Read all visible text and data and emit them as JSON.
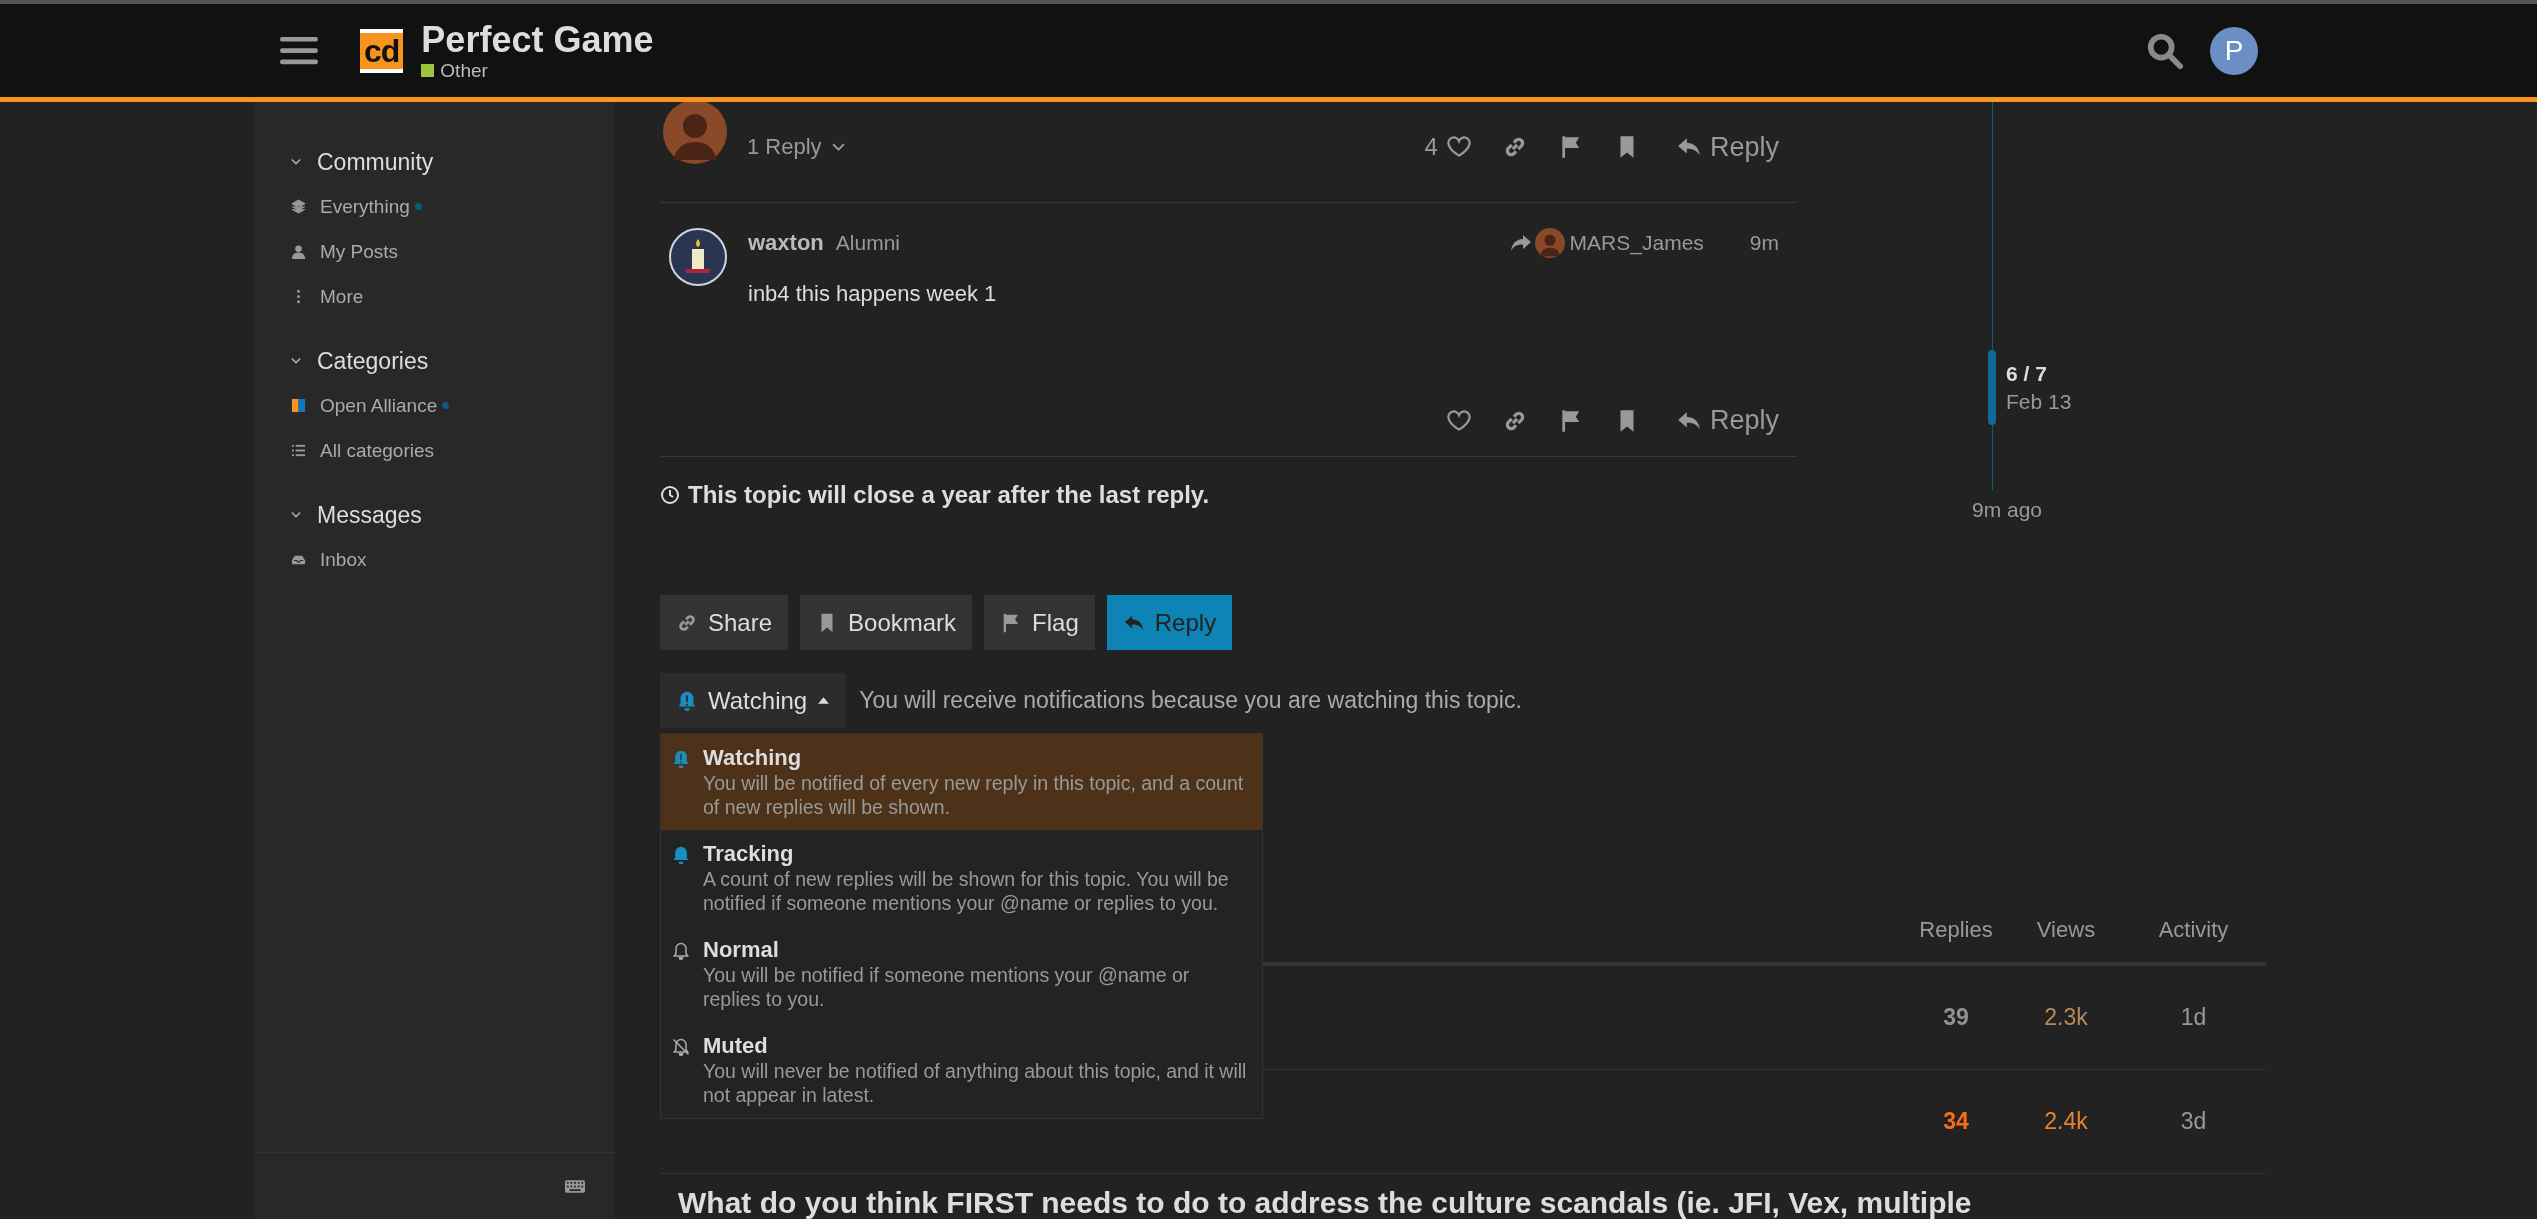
{
  "header": {
    "logo": "cd",
    "title": "Perfect Game",
    "category": {
      "name": "Other",
      "color": "#9bc53d"
    },
    "avatar_letter": "P"
  },
  "sidebar": {
    "sections": [
      {
        "title": "Community",
        "expanded": true,
        "items": [
          {
            "label": "Everything",
            "kind": "layers",
            "unread": true
          },
          {
            "label": "My Posts",
            "kind": "person",
            "unread": false
          },
          {
            "label": "More",
            "kind": "dots",
            "unread": false
          }
        ]
      },
      {
        "title": "Categories",
        "expanded": true,
        "items": [
          {
            "label": "Open Alliance",
            "kind": "category",
            "unread": true
          },
          {
            "label": "All categories",
            "kind": "list",
            "unread": false
          }
        ]
      },
      {
        "title": "Messages",
        "expanded": true,
        "items": [
          {
            "label": "Inbox",
            "kind": "inbox",
            "unread": false
          }
        ]
      }
    ]
  },
  "posts": [
    {
      "kind": "tail",
      "reply_count": "1 Reply",
      "likes": "4",
      "reply_label": "Reply"
    },
    {
      "kind": "full",
      "username": "waxton",
      "user_title": "Alumni",
      "reply_to": "MARS_James",
      "age": "9m",
      "body": "inb4 this happens week 1",
      "reply_label": "Reply"
    }
  ],
  "notice": "This topic will close a year after the last reply.",
  "timeline": {
    "position": "6 / 7",
    "date": "Feb 13",
    "last": "9m ago"
  },
  "buttons": [
    {
      "label": "Share",
      "kind": "link",
      "primary": false
    },
    {
      "label": "Bookmark",
      "kind": "bookmark",
      "primary": false
    },
    {
      "label": "Flag",
      "kind": "flag",
      "primary": false
    },
    {
      "label": "Reply",
      "kind": "reply",
      "primary": true
    }
  ],
  "notifications": {
    "level": "Watching",
    "expanded": true,
    "description": "You will receive notifications because you are watching this topic.",
    "options": [
      {
        "kind": "watching",
        "title": "Watching",
        "text": "You will be notified of every new reply in this topic, and a count of new replies will be shown.",
        "selected": true
      },
      {
        "kind": "tracking",
        "title": "Tracking",
        "text": "A count of new replies will be shown for this topic. You will be notified if someone mentions your @name or replies to you.",
        "selected": false
      },
      {
        "kind": "normal",
        "title": "Normal",
        "text": "You will be notified if someone mentions your @name or replies to you.",
        "selected": false
      },
      {
        "kind": "muted",
        "title": "Muted",
        "text": "You will never be notified of anything about this topic, and it will not appear in latest.",
        "selected": false
      }
    ]
  },
  "topics": {
    "columns": [
      "Replies",
      "Views",
      "Activity"
    ],
    "rows": [
      {
        "replies": {
          "text": "39",
          "color": "#919191"
        },
        "views": {
          "text": "2.3k",
          "color": "#b7895a"
        },
        "activity": "1d"
      },
      {
        "replies": {
          "text": "34",
          "color": "#fa6c17"
        },
        "views": {
          "text": "2.4k",
          "color": "#e8832d"
        },
        "activity": "3d"
      }
    ],
    "next_title": "What do you think FIRST needs to do to address the culture scandals (ie. JFI, Vex, multiple"
  }
}
